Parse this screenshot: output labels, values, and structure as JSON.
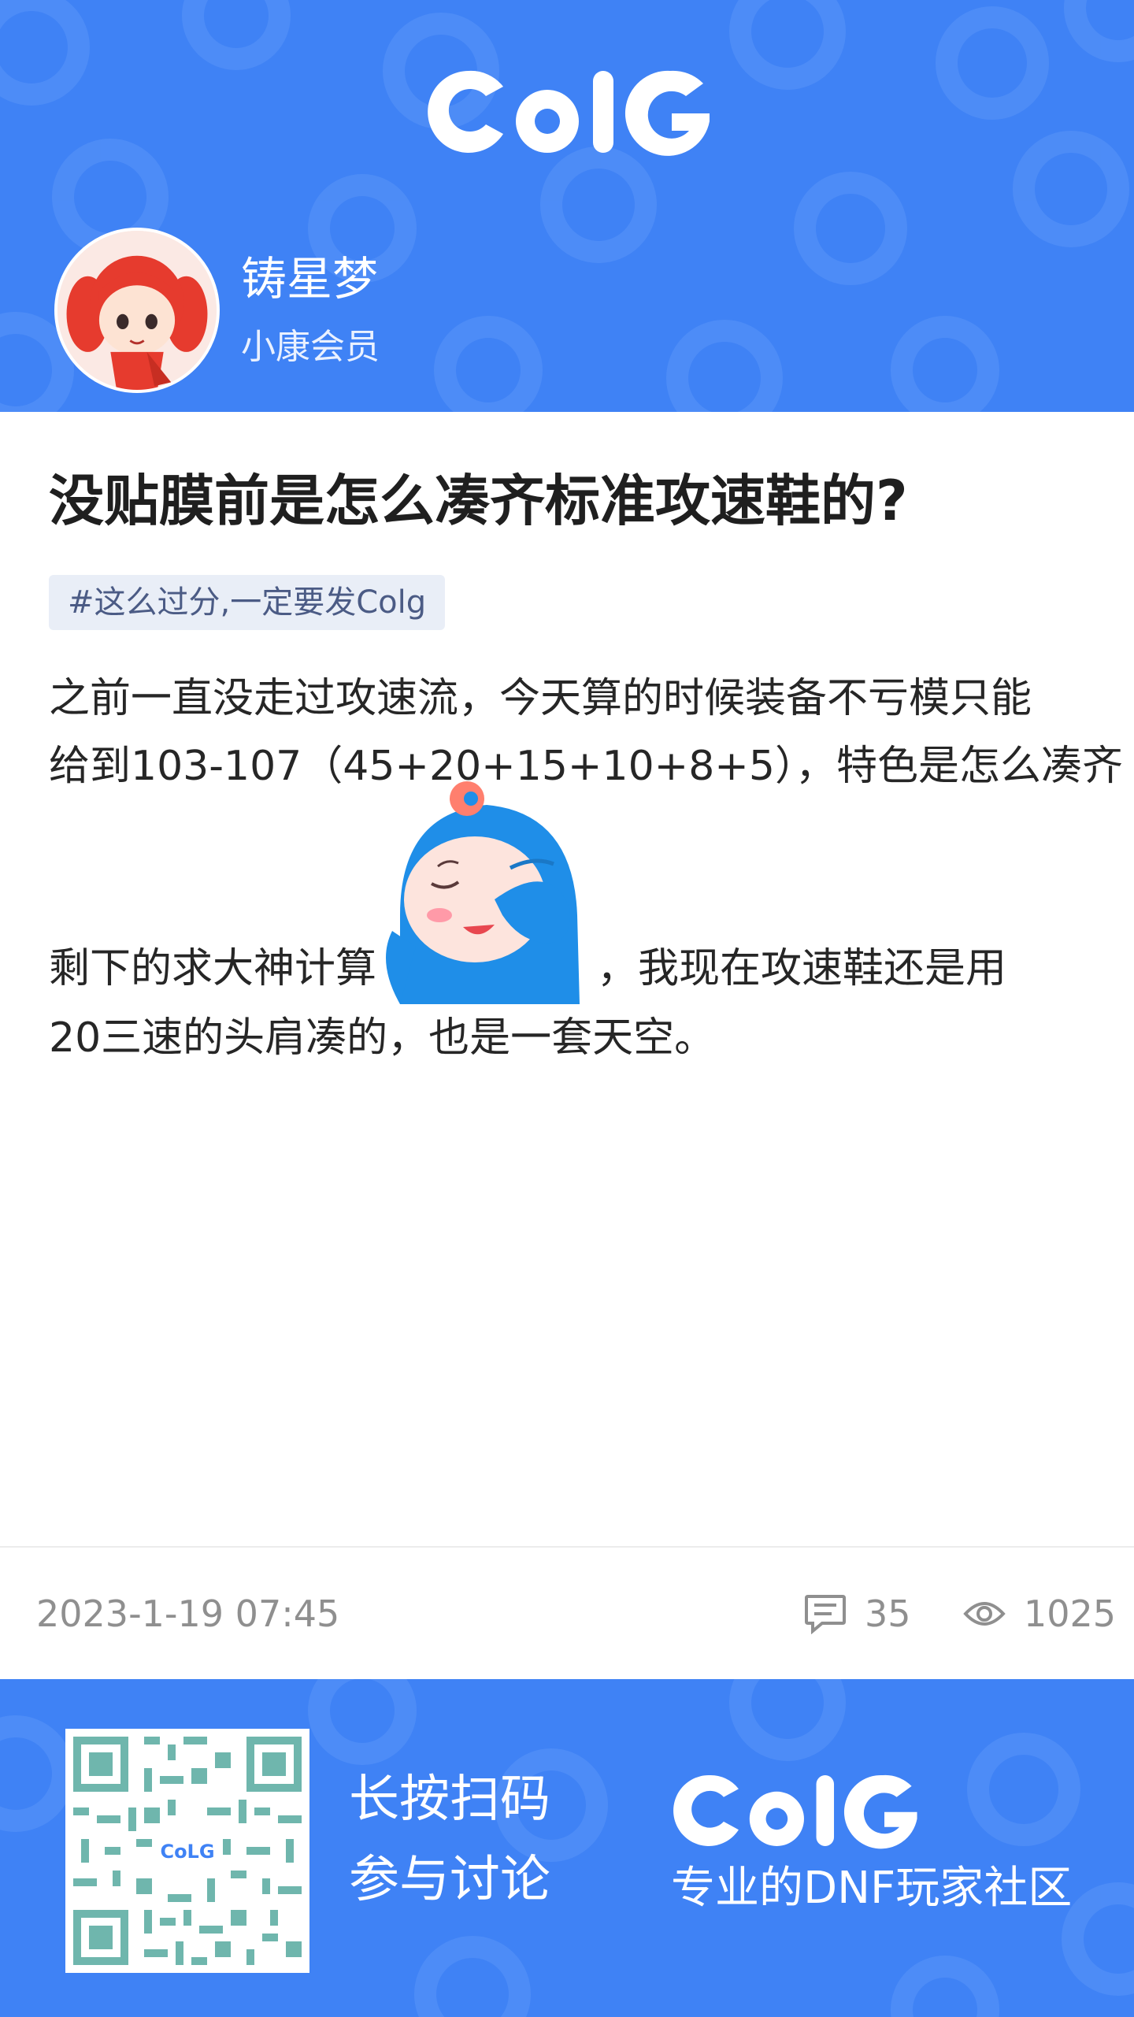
{
  "brand": {
    "logo_text": "CoLG",
    "qr_center_text": "CoLG"
  },
  "colors": {
    "brand_blue": "#3f82f5",
    "title_text": "#1f1f1f",
    "meta_gray": "#8f8f8f",
    "tag_bg": "#e9eef7",
    "tag_text": "#4b5b85"
  },
  "author": {
    "name": "铸星梦",
    "level": "小康会员",
    "avatar_icon": "avatar-girl-red-hair"
  },
  "post": {
    "title": "没贴膜前是怎么凑齐标准攻速鞋的?",
    "tag": "#这么过分,一定要发Colg",
    "body": {
      "line1": "之前一直没走过攻速流，今天算的时候装备不亏模只能",
      "line2": "给到103-107（45+20+15+10+8+5），特色是怎么凑齐",
      "line3_before": "剩下的求大神计算",
      "sticker_icon": "facepalm-sticker",
      "line3_after": "，我现在攻速鞋还是用",
      "line4": "20三速的头肩凑的，也是一套天空。"
    },
    "date": "2023-1-19 07:45",
    "comments": "35",
    "views": "1025",
    "comment_icon": "comment-icon",
    "view_icon": "eye-icon"
  },
  "footer": {
    "cta_line1": "长按扫码",
    "cta_line2": "参与讨论",
    "slogan": "专业的DNF玩家社区",
    "qr_icon": "qr-code"
  }
}
